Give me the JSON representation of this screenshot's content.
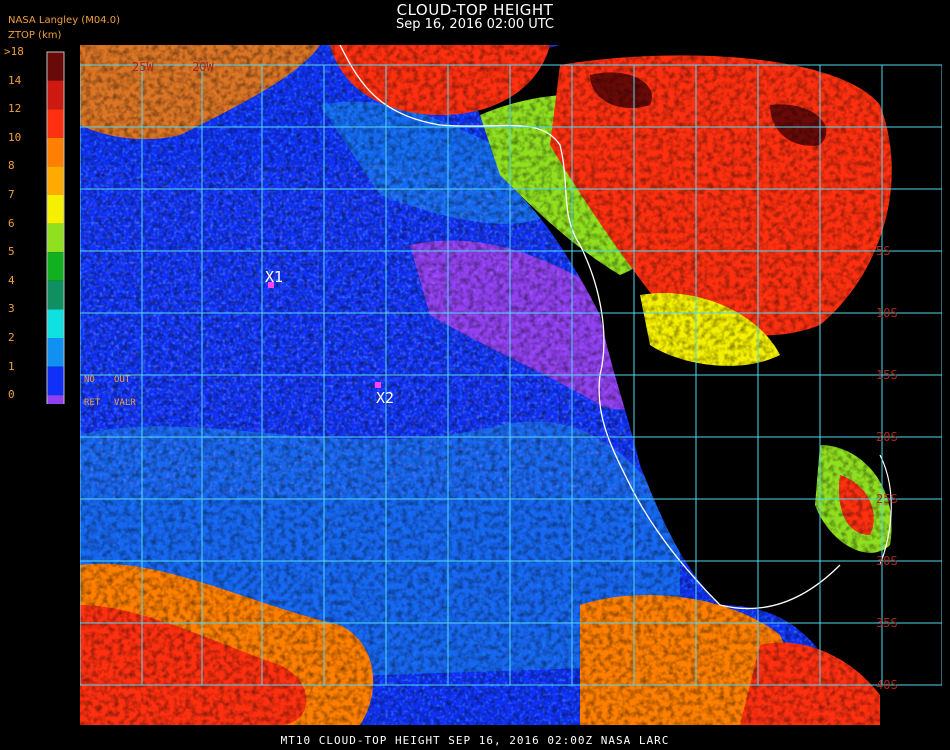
{
  "header": {
    "title": "CLOUD-TOP HEIGHT",
    "subtitle": "Sep 16, 2016 02:00 UTC",
    "org": "NASA Langley (M04.0)",
    "unit": "ZTOP (km)"
  },
  "legend": {
    "labels": [
      ">18",
      "14",
      "12",
      "10",
      "8",
      "7",
      "6",
      "5",
      "4",
      "3",
      "2",
      "1",
      "0"
    ],
    "colors": [
      "#6a0a08",
      "#cc1a10",
      "#ff3010",
      "#ff8000",
      "#ffaa00",
      "#f4f000",
      "#90e020",
      "#10b020",
      "#109060",
      "#10e0e0",
      "#1090f0",
      "#1030f8",
      "#9040f0"
    ],
    "no_ret": "NO",
    "out": "OUT",
    "ret": "RET",
    "valr": "VALR"
  },
  "map": {
    "lon_labels": [
      "25W",
      "20W"
    ],
    "lat_labels": [
      "5S",
      "10S",
      "15S",
      "20S",
      "25S",
      "30S",
      "35S",
      "40S"
    ],
    "markers": [
      {
        "label": "X1",
        "color": "#ff40ff"
      },
      {
        "label": "X2",
        "color": "#ff40ff"
      }
    ],
    "colors": {
      "grid": "#50d8f0",
      "ocean": "#1030f8",
      "coast": "#ffffff",
      "land": "#000000"
    }
  },
  "footer": "MT10  CLOUD-TOP HEIGHT   SEP 16, 2016 02:00Z   NASA LARC"
}
